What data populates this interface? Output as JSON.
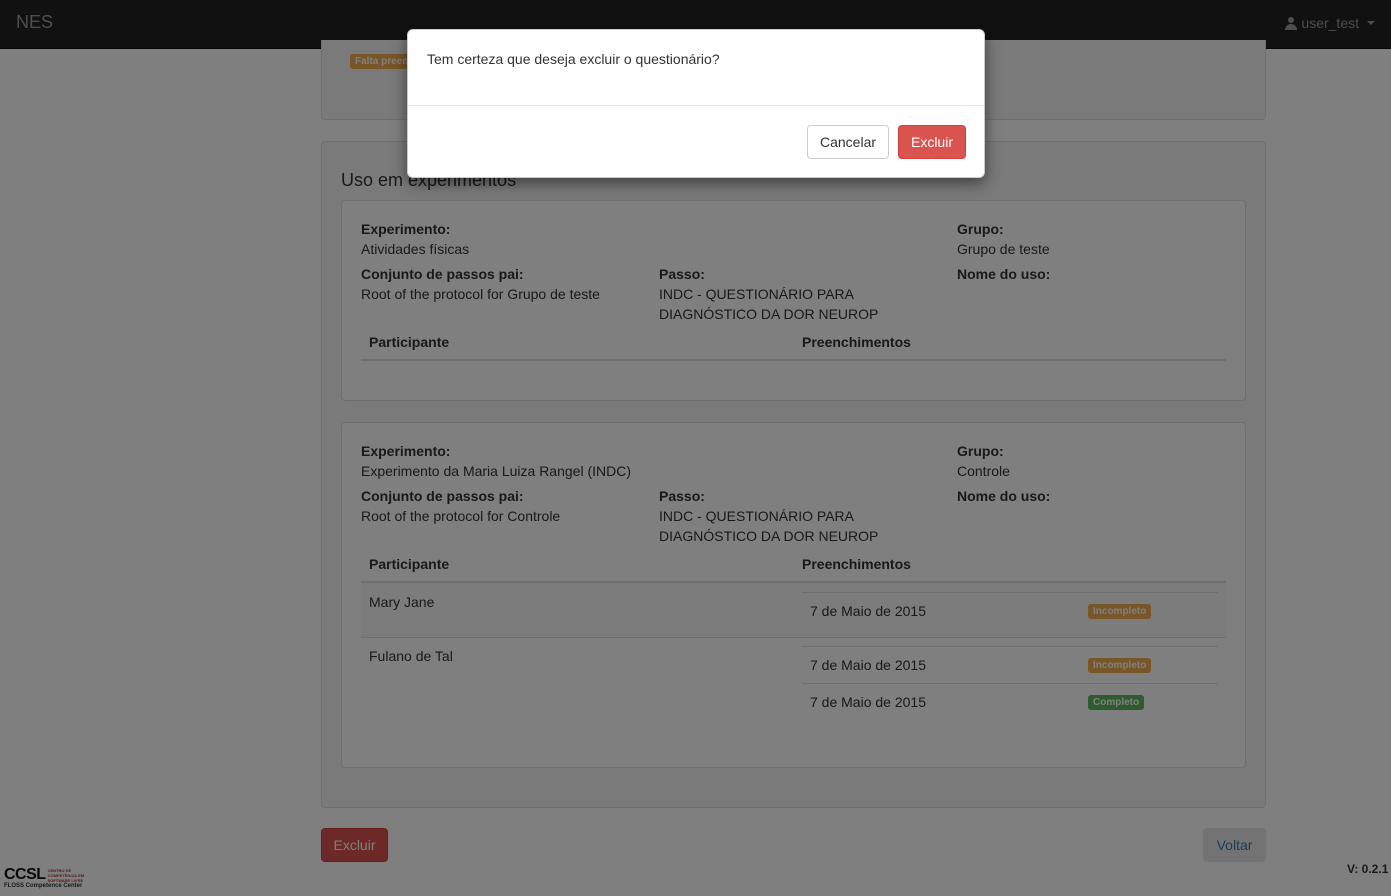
{
  "navbar": {
    "brand": "NES",
    "user": "user_test"
  },
  "top_panel": {
    "badge": "Falta preenchimento"
  },
  "usage_section": {
    "title": "Uso em experimentos",
    "experiments": [
      {
        "experiment_label": "Experimento:",
        "experiment_value": "Atividades físicas",
        "group_label": "Grupo:",
        "group_value": "Grupo de teste",
        "parent_steps_label": "Conjunto de passos pai:",
        "parent_steps_value": "Root of the protocol for Grupo de teste",
        "step_label": "Passo:",
        "step_value_line1": "INDC - QUESTIONÁRIO PARA",
        "step_value_line2": "DIAGNÓSTICO DA DOR NEUROP",
        "use_name_label": "Nome do uso:",
        "col_participant": "Participante",
        "col_fills": "Preenchimentos"
      },
      {
        "experiment_label": "Experimento:",
        "experiment_value": "Experimento da Maria Luiza Rangel (INDC)",
        "group_label": "Grupo:",
        "group_value": "Controle",
        "parent_steps_label": "Conjunto de passos pai:",
        "parent_steps_value": "Root of the protocol for Controle",
        "step_label": "Passo:",
        "step_value_line1": "INDC - QUESTIONÁRIO PARA",
        "step_value_line2": "DIAGNÓSTICO DA DOR NEUROP",
        "use_name_label": "Nome do uso:",
        "col_participant": "Participante",
        "col_fills": "Preenchimentos",
        "rows": [
          {
            "participant": "Mary Jane",
            "fills": [
              {
                "date": "7 de Maio de 2015",
                "status": "Incompleto"
              }
            ]
          },
          {
            "participant": "Fulano de Tal",
            "fills": [
              {
                "date": "7 de Maio de 2015",
                "status": "Incompleto"
              },
              {
                "date": "7 de Maio de 2015",
                "status": "Completo"
              }
            ]
          }
        ]
      }
    ]
  },
  "actions": {
    "delete": "Excluir",
    "back": "Voltar"
  },
  "footer": {
    "logo": "CCSL",
    "logo_small": "CENTRO DE COMPETÊNCIA EM SOFTWARE LIVRE",
    "logo_sub": "FLOSS Competence Center",
    "version": "V: 0.2.1"
  },
  "modal": {
    "message": "Tem certeza que deseja excluir o questionário?",
    "cancel": "Cancelar",
    "confirm": "Excluir"
  },
  "colors": {
    "danger": "#d9534f",
    "warning": "#f0ad4e",
    "success": "#5cb85c",
    "navbar": "#222222"
  }
}
